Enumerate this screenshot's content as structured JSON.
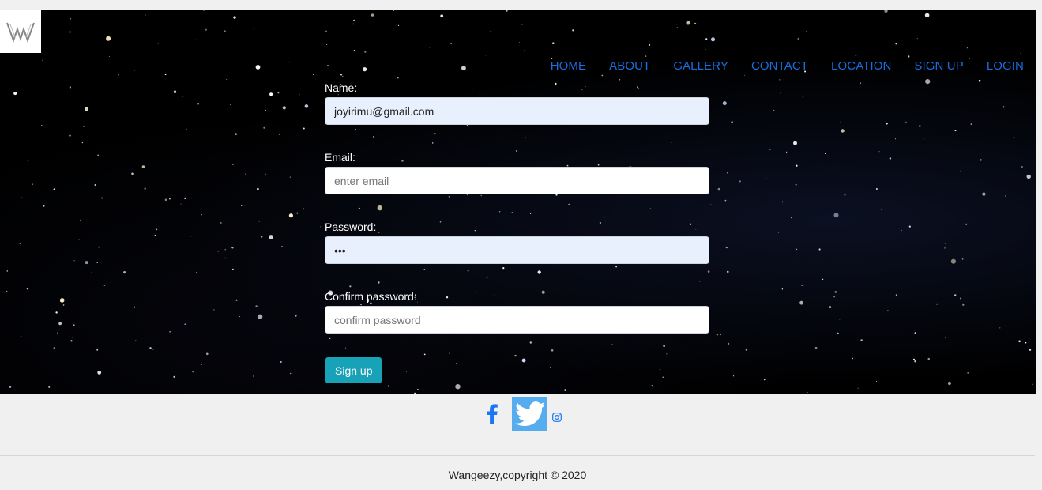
{
  "brand": {
    "logo_icon": "wangeezy-logo-icon"
  },
  "nav": {
    "items": [
      {
        "label": "HOME"
      },
      {
        "label": "ABOUT"
      },
      {
        "label": "GALLERY"
      },
      {
        "label": "CONTACT"
      },
      {
        "label": "LOCATION"
      },
      {
        "label": "SIGN UP"
      },
      {
        "label": "LOGIN"
      }
    ],
    "color": "#1a6de0"
  },
  "form": {
    "name": {
      "label": "Name:",
      "value": "joyirimu@gmail.com",
      "placeholder": ""
    },
    "email": {
      "label": "Email:",
      "value": "",
      "placeholder": "enter email"
    },
    "password": {
      "label": "Password:",
      "value": "abc",
      "placeholder": ""
    },
    "confirm": {
      "label": "Confirm password:",
      "value": "",
      "placeholder": "confirm password"
    },
    "submit_label": "Sign up",
    "submit_color": "#17a2b8"
  },
  "social": {
    "facebook_icon": "facebook-icon",
    "twitter_icon": "twitter-icon",
    "instagram_icon": "instagram-icon",
    "twitter_color": "#55acee",
    "facebook_color": "#1877f2"
  },
  "footer": {
    "text": "Wangeezy,copyright © 2020"
  }
}
